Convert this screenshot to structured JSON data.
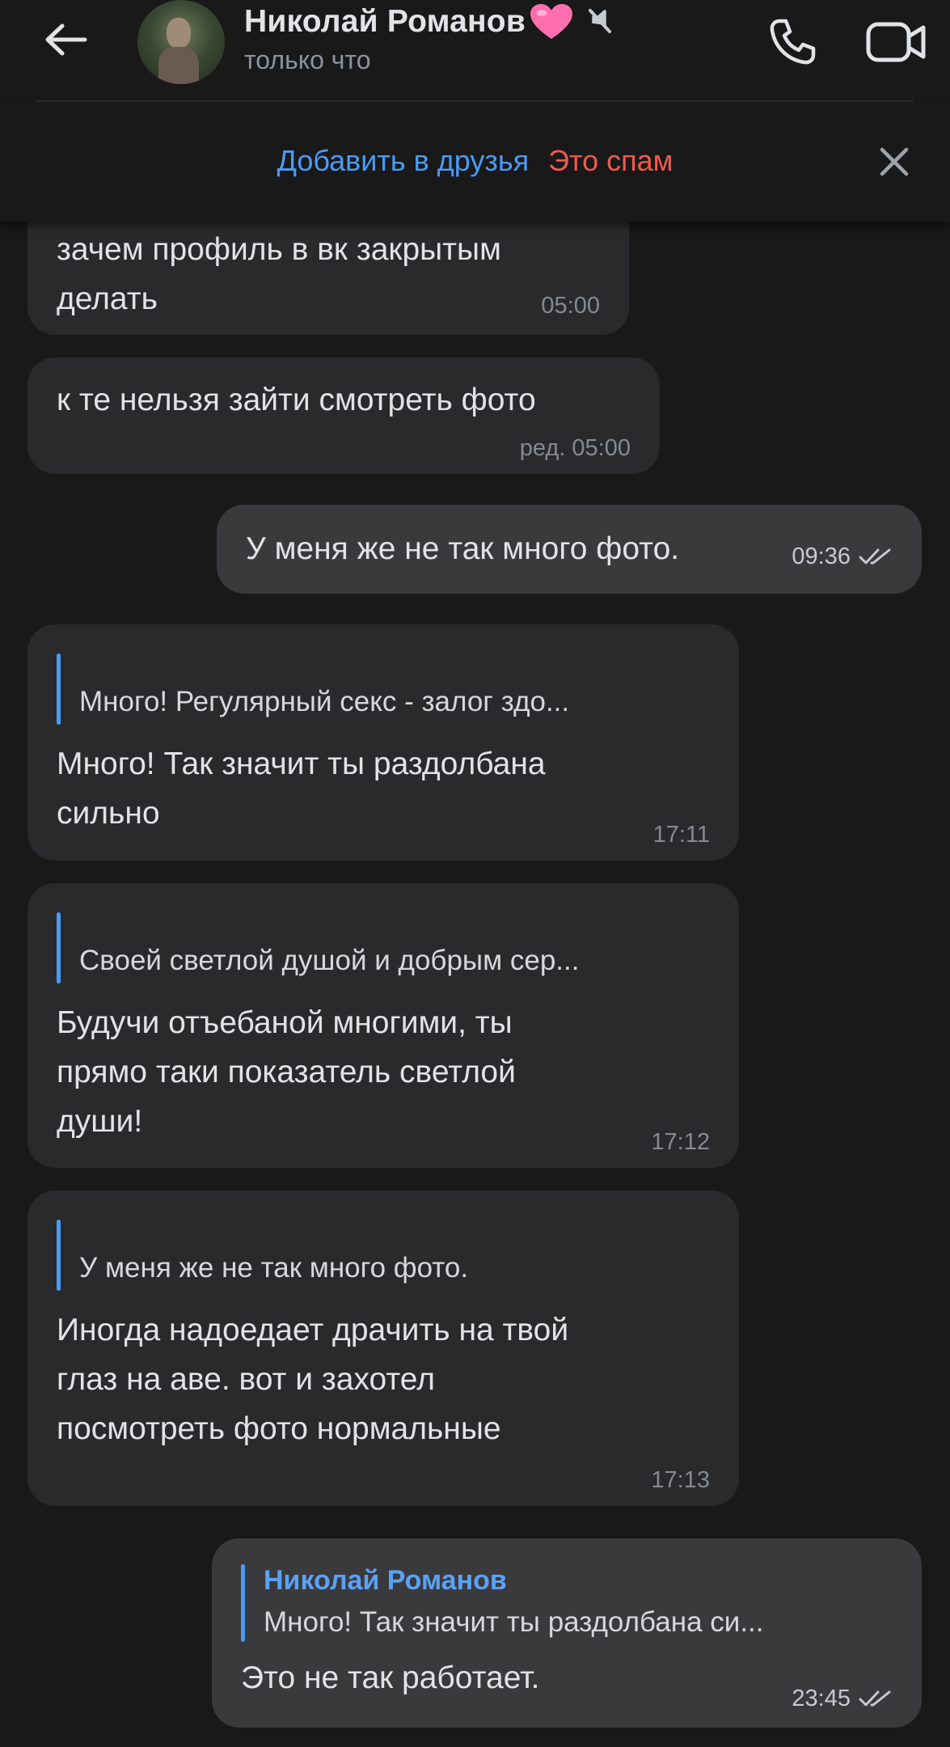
{
  "header": {
    "contact_name": "Николай Романов",
    "status": "только что",
    "icons": {
      "back": "arrow-left-icon",
      "heart": "heart-emoji-icon",
      "mute": "muted-bell-icon",
      "call": "phone-icon",
      "video": "video-camera-icon"
    }
  },
  "actions": {
    "add_friend": "Добавить в друзья",
    "spam": "Это спам",
    "close": "close-icon"
  },
  "colors": {
    "background": "#19191a",
    "incoming_bubble": "#2a2a2c",
    "outgoing_bubble": "#3a3a3c",
    "accent_blue": "#4b9bf5",
    "spam_red": "#ee5a50",
    "heart_pink": "#ff6fb0"
  },
  "messages": [
    {
      "direction": "in",
      "text": "зачем профиль в вк закрытым\nделать",
      "time": "05:00"
    },
    {
      "direction": "in",
      "text": "к те нельзя зайти смотреть фото",
      "time": "ред. 05:00"
    },
    {
      "direction": "out",
      "text": "У меня же не так много фото.",
      "time": "09:36",
      "read": true
    },
    {
      "direction": "in",
      "quote": "Много! Регулярный секс - залог здо...",
      "text": "Много! Так значит ты раздолбана\nсильно",
      "time": "17:11"
    },
    {
      "direction": "in",
      "quote": "Своей светлой душой и добрым сер...",
      "text": "Будучи отъебаной многими, ты\nпрямо таки показатель светлой\nдуши!",
      "time": "17:12"
    },
    {
      "direction": "in",
      "quote": "У меня же не так много фото.",
      "text": "Иногда надоедает драчить на твой\nглаз на аве. вот и захотел\nпосмотреть фото нормальные",
      "time": "17:13"
    },
    {
      "direction": "out",
      "quote_author": "Николай Романов",
      "quote": "Много! Так значит ты раздолбана си...",
      "text": "Это не так работает.",
      "time": "23:45",
      "read": true
    }
  ]
}
